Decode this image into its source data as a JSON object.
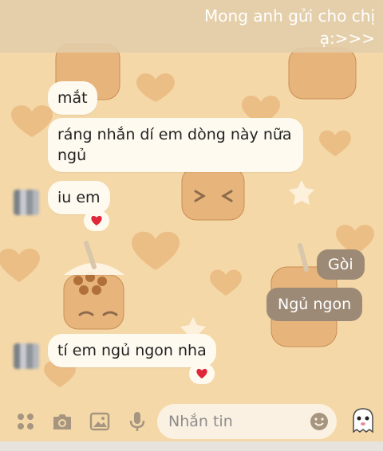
{
  "story_caption": {
    "text": "Mong anh gửi cho chị ạ:>>>"
  },
  "messages": [
    {
      "from": "them",
      "text": "mắt"
    },
    {
      "from": "them",
      "text": "ráng nhắn dí em dòng này nữa ngủ"
    },
    {
      "from": "them",
      "text": "iu em",
      "reaction": "heart-icon"
    },
    {
      "from": "me",
      "text": "Gòi"
    },
    {
      "from": "me",
      "text": "Ngủ ngon"
    },
    {
      "from": "them",
      "text": "tí em ngủ ngon nha",
      "reaction": "heart-icon"
    }
  ],
  "composer": {
    "placeholder": "Nhắn tin",
    "icons": [
      "apps-icon",
      "camera-icon",
      "gallery-icon",
      "microphone-icon",
      "emoji-icon",
      "ghost-sticker-icon"
    ]
  },
  "colors": {
    "wallpaper": "#f4d8a8",
    "incoming_bubble": "#fffaf0",
    "outgoing_bubble": "#9c8a76",
    "heart": "#e0263b"
  }
}
